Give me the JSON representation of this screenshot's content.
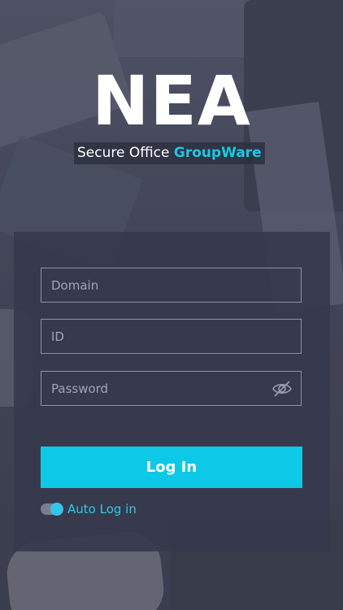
{
  "brand": {
    "logo": "NEA",
    "tagline_prefix": "Secure Office",
    "tagline_accent": "GroupWare",
    "accent_color": "#0ec9e6"
  },
  "form": {
    "domain_placeholder": "Domain",
    "id_placeholder": "ID",
    "password_placeholder": "Password",
    "password_toggle_icon": "eye-off-icon",
    "login_label": "Log In",
    "auto_login_label": "Auto Log in",
    "auto_login_on": true
  }
}
